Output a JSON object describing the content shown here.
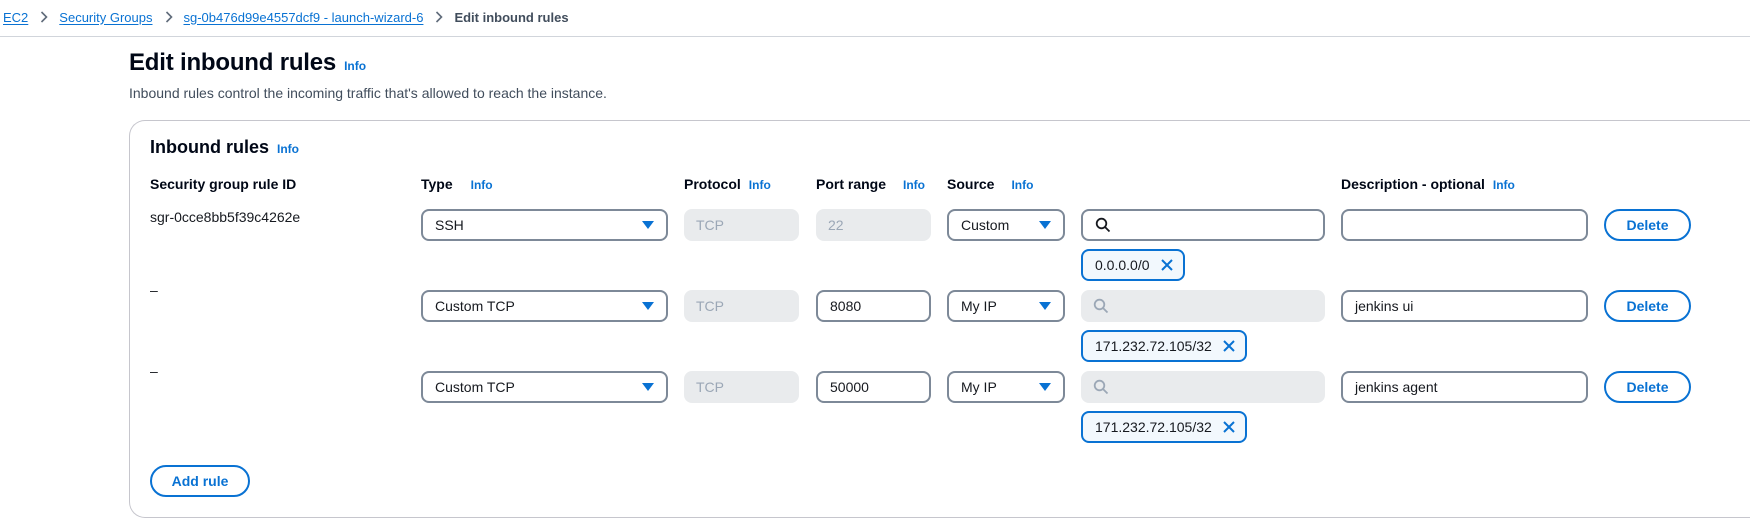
{
  "breadcrumb": {
    "items": [
      "EC2",
      "Security Groups",
      "sg-0b476d99e4557dcf9 - launch-wizard-6"
    ],
    "current": "Edit inbound rules"
  },
  "page": {
    "title": "Edit inbound rules",
    "info": "Info",
    "description": "Inbound rules control the incoming traffic that's allowed to reach the instance."
  },
  "panel": {
    "title": "Inbound rules",
    "info": "Info",
    "columns": {
      "rule_id": "Security group rule ID",
      "type": "Type",
      "protocol": "Protocol",
      "port_range": "Port range",
      "source": "Source",
      "description": "Description - optional"
    },
    "column_info": "Info",
    "rows": [
      {
        "rule_id": "sgr-0cce8bb5f39c4262e",
        "type": "SSH",
        "protocol": "TCP",
        "port_range": "22",
        "source": "Custom",
        "search_value": "",
        "token": "0.0.0.0/0",
        "description": "",
        "delete_label": "Delete"
      },
      {
        "rule_id": "–",
        "type": "Custom TCP",
        "protocol": "TCP",
        "port_range": "8080",
        "source": "My IP",
        "search_value": "",
        "token": "171.232.72.105/32",
        "description": "jenkins ui",
        "delete_label": "Delete"
      },
      {
        "rule_id": "–",
        "type": "Custom TCP",
        "protocol": "TCP",
        "port_range": "50000",
        "source": "My IP",
        "search_value": "",
        "token": "171.232.72.105/32",
        "description": "jenkins agent",
        "delete_label": "Delete"
      }
    ],
    "add_rule_label": "Add rule"
  },
  "colors": {
    "link": "#0972d3",
    "border": "#7d8998",
    "disabled_bg": "#e9ebed",
    "token_bg": "#f2f8fd"
  }
}
